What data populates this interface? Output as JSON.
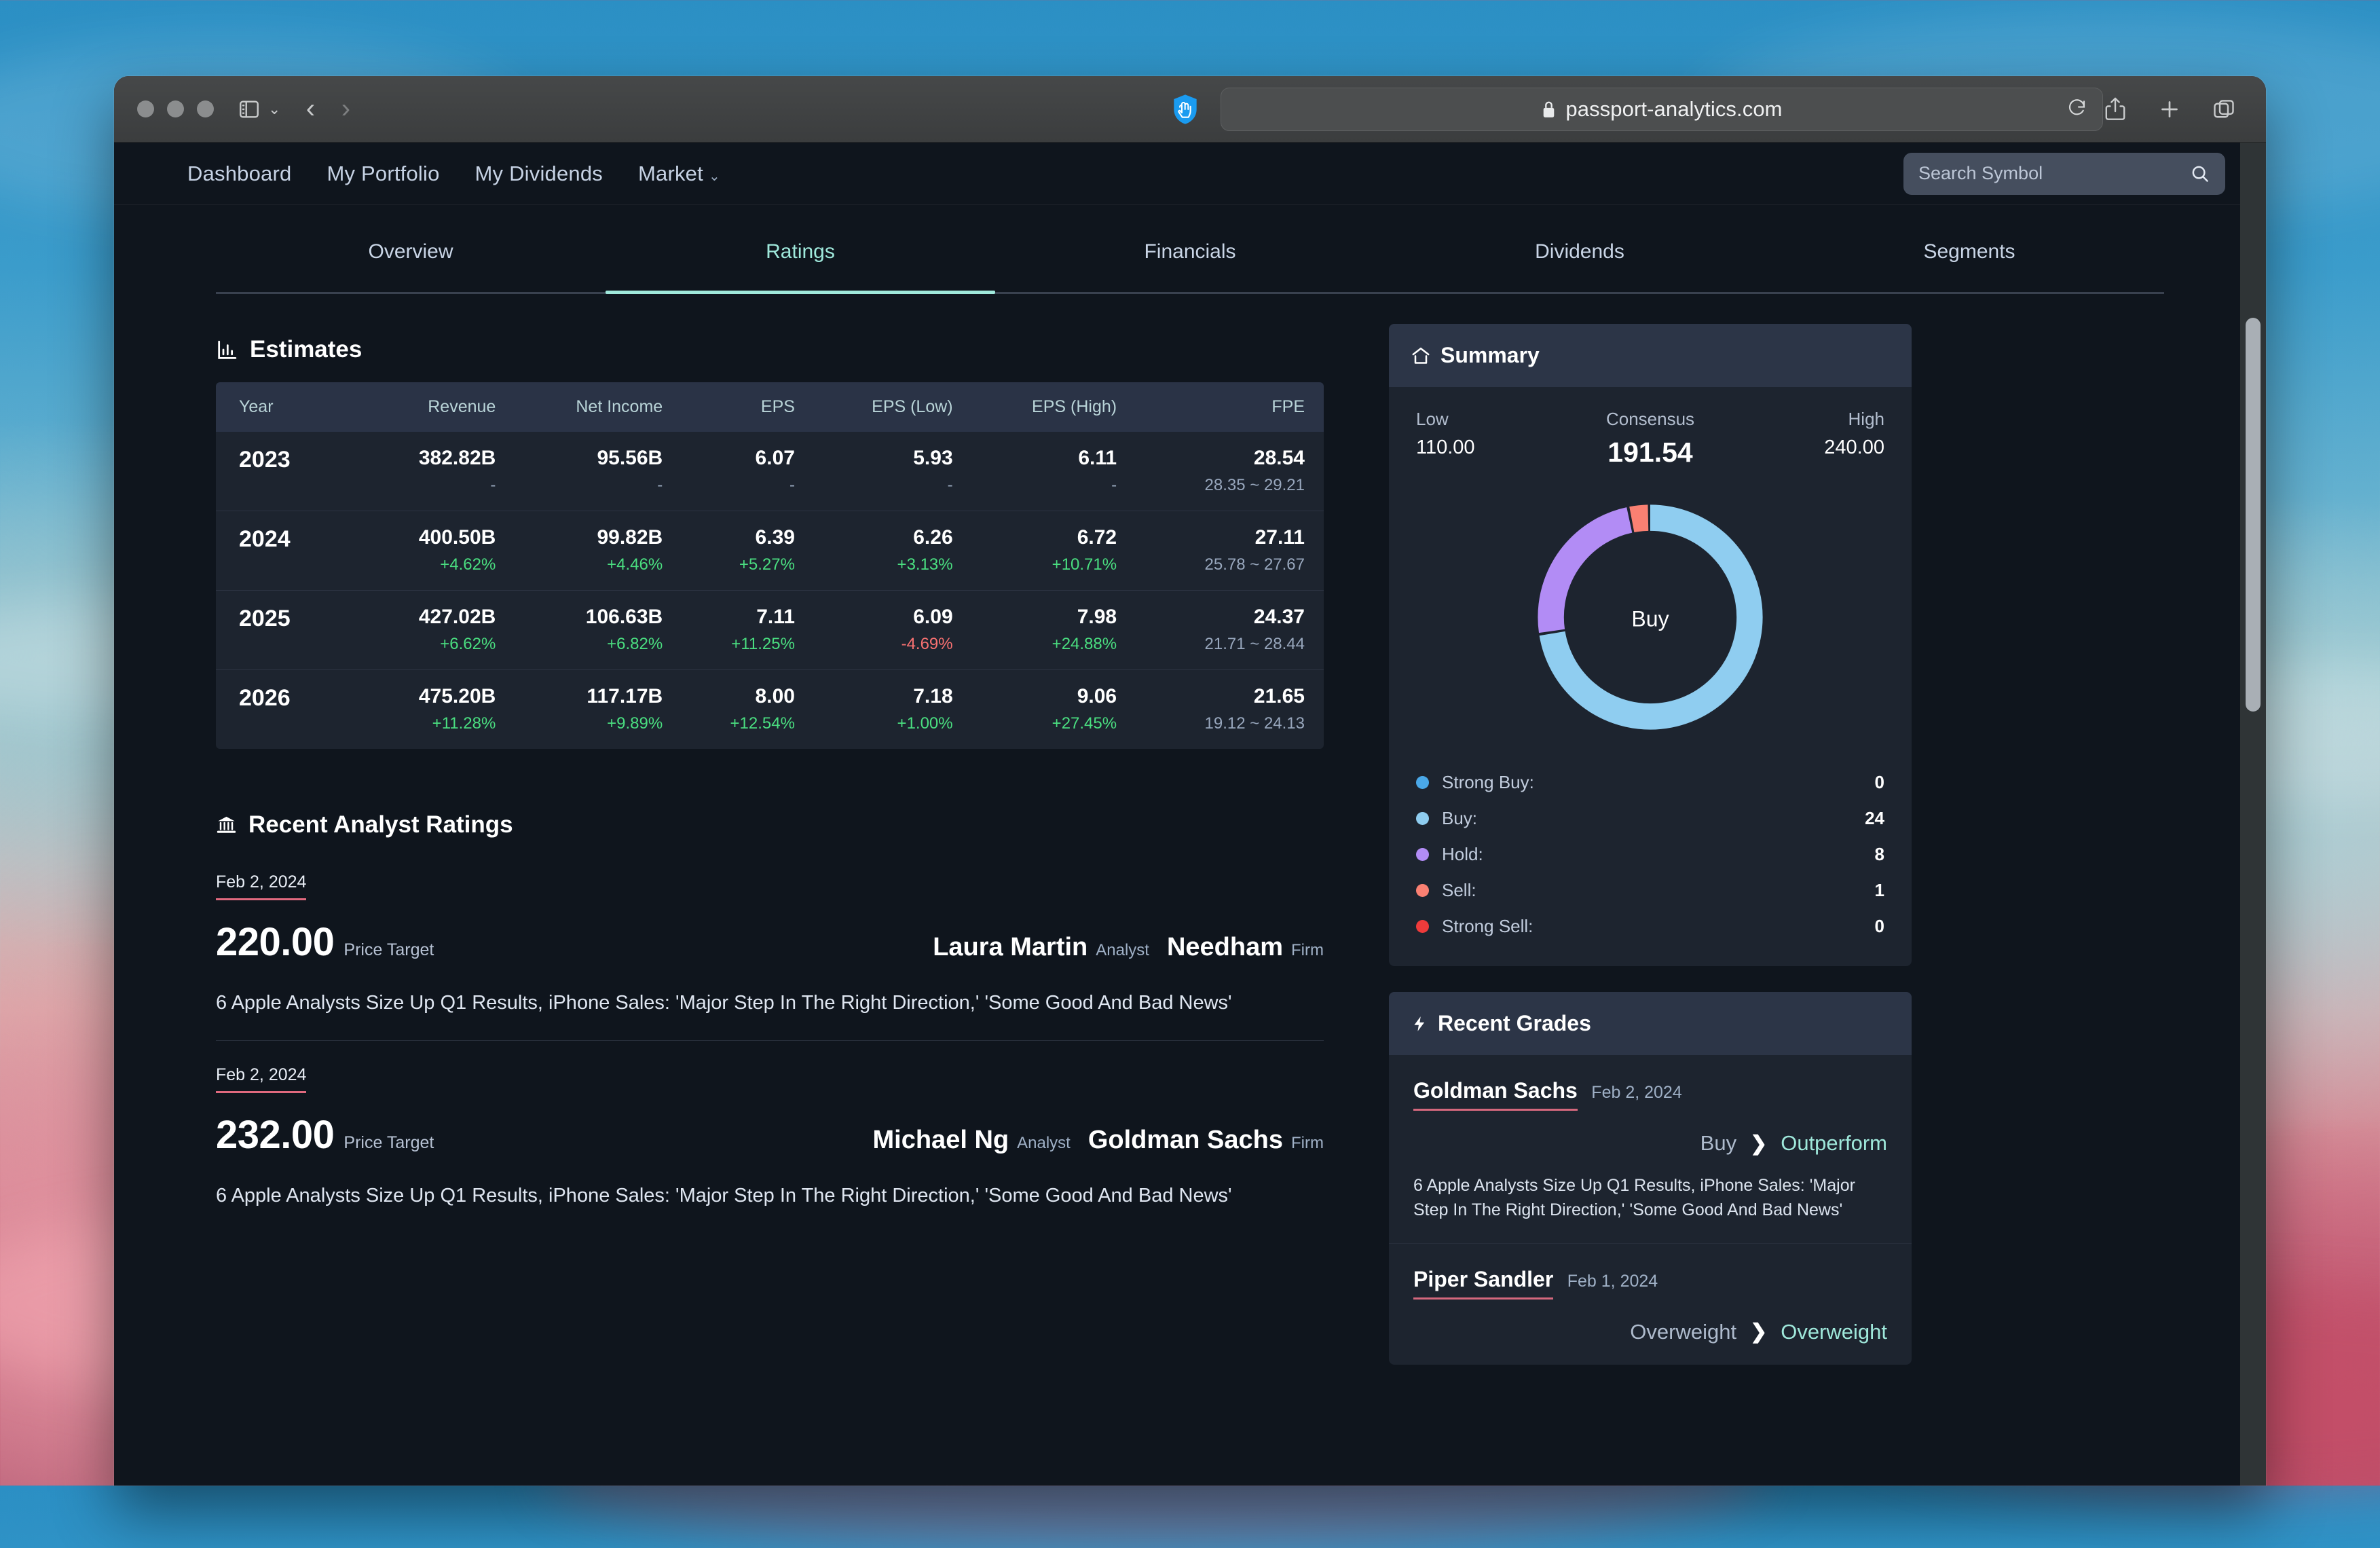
{
  "browser": {
    "url": "passport-analytics.com",
    "lock_icon": "lock-icon",
    "reload_icon": "reload-icon",
    "back_icon": "back-chevron-icon",
    "forward_icon": "forward-chevron-icon",
    "sidebar_icon": "sidebar-toggle-icon",
    "shield_icon": "extension-shield-icon",
    "share_icon": "share-icon",
    "new_tab_icon": "plus-icon",
    "tabs_icon": "tab-overview-icon"
  },
  "header": {
    "nav": [
      {
        "label": "Dashboard",
        "caret": ""
      },
      {
        "label": "My Portfolio",
        "caret": ""
      },
      {
        "label": "My Dividends",
        "caret": ""
      },
      {
        "label": "Market",
        "caret": "⌄"
      }
    ],
    "search": {
      "placeholder": "Search Symbol",
      "value": "",
      "icon": "search-icon"
    }
  },
  "tabs": [
    {
      "label": "Overview",
      "active": false
    },
    {
      "label": "Ratings",
      "active": true
    },
    {
      "label": "Financials",
      "active": false
    },
    {
      "label": "Dividends",
      "active": false
    },
    {
      "label": "Segments",
      "active": false
    }
  ],
  "estimates": {
    "title": "Estimates",
    "icon": "bar-chart-icon",
    "columns": [
      "Year",
      "Revenue",
      "Net Income",
      "EPS",
      "EPS (Low)",
      "EPS (High)",
      "FPE"
    ],
    "rows": [
      {
        "year": "2023",
        "revenue": "382.82B",
        "revenue_chg": "-",
        "revenue_dir": "neutral",
        "net_income": "95.56B",
        "net_income_chg": "-",
        "net_income_dir": "neutral",
        "eps": "6.07",
        "eps_chg": "-",
        "eps_dir": "neutral",
        "eps_low": "5.93",
        "eps_low_chg": "-",
        "eps_low_dir": "neutral",
        "eps_high": "6.11",
        "eps_high_chg": "-",
        "eps_high_dir": "neutral",
        "fpe": "28.54",
        "fpe_range": "28.35 ~ 29.21"
      },
      {
        "year": "2024",
        "revenue": "400.50B",
        "revenue_chg": "+4.62%",
        "revenue_dir": "pos",
        "net_income": "99.82B",
        "net_income_chg": "+4.46%",
        "net_income_dir": "pos",
        "eps": "6.39",
        "eps_chg": "+5.27%",
        "eps_dir": "pos",
        "eps_low": "6.26",
        "eps_low_chg": "+3.13%",
        "eps_low_dir": "pos",
        "eps_high": "6.72",
        "eps_high_chg": "+10.71%",
        "eps_high_dir": "pos",
        "fpe": "27.11",
        "fpe_range": "25.78 ~ 27.67"
      },
      {
        "year": "2025",
        "revenue": "427.02B",
        "revenue_chg": "+6.62%",
        "revenue_dir": "pos",
        "net_income": "106.63B",
        "net_income_chg": "+6.82%",
        "net_income_dir": "pos",
        "eps": "7.11",
        "eps_chg": "+11.25%",
        "eps_dir": "pos",
        "eps_low": "6.09",
        "eps_low_chg": "-4.69%",
        "eps_low_dir": "neg",
        "eps_high": "7.98",
        "eps_high_chg": "+24.88%",
        "eps_high_dir": "pos",
        "fpe": "24.37",
        "fpe_range": "21.71 ~ 28.44"
      },
      {
        "year": "2026",
        "revenue": "475.20B",
        "revenue_chg": "+11.28%",
        "revenue_dir": "pos",
        "net_income": "117.17B",
        "net_income_chg": "+9.89%",
        "net_income_dir": "pos",
        "eps": "8.00",
        "eps_chg": "+12.54%",
        "eps_dir": "pos",
        "eps_low": "7.18",
        "eps_low_chg": "+1.00%",
        "eps_low_dir": "pos",
        "eps_high": "9.06",
        "eps_high_chg": "+27.45%",
        "eps_high_dir": "pos",
        "fpe": "21.65",
        "fpe_range": "19.12 ~ 24.13"
      }
    ]
  },
  "analyst_ratings": {
    "title": "Recent Analyst Ratings",
    "icon": "bank-icon",
    "price_target_label": "Price Target",
    "analyst_label": "Analyst",
    "firm_label": "Firm",
    "items": [
      {
        "date": "Feb 2, 2024",
        "price": "220.00",
        "analyst": "Laura Martin",
        "firm": "Needham",
        "news": "6 Apple Analysts Size Up Q1 Results, iPhone Sales: 'Major Step In The Right Direction,' 'Some Good And Bad News'"
      },
      {
        "date": "Feb 2, 2024",
        "price": "232.00",
        "analyst": "Michael Ng",
        "firm": "Goldman Sachs",
        "news": "6 Apple Analysts Size Up Q1 Results, iPhone Sales: 'Major Step In The Right Direction,' 'Some Good And Bad News'"
      }
    ]
  },
  "summary": {
    "title": "Summary",
    "icon": "home-icon",
    "low_label": "Low",
    "low_value": "110.00",
    "consensus_label": "Consensus",
    "consensus_value": "191.54",
    "high_label": "High",
    "high_value": "240.00",
    "donut_center_label": "Buy",
    "legend": [
      {
        "label": "Strong Buy:",
        "value": "0",
        "color": "#4aa8e8"
      },
      {
        "label": "Buy:",
        "value": "24",
        "color": "#8fcdf0"
      },
      {
        "label": "Hold:",
        "value": "8",
        "color": "#b28cf5"
      },
      {
        "label": "Sell:",
        "value": "1",
        "color": "#fa8072"
      },
      {
        "label": "Strong Sell:",
        "value": "0",
        "color": "#ef3b3b"
      }
    ]
  },
  "recent_grades": {
    "title": "Recent Grades",
    "icon": "bolt-icon",
    "items": [
      {
        "firm": "Goldman Sachs",
        "date": "Feb 2, 2024",
        "from": "Buy",
        "arrow": "❯",
        "to": "Outperform",
        "news": "6 Apple Analysts Size Up Q1 Results, iPhone Sales: 'Major Step In The Right Direction,' 'Some Good And Bad News'"
      },
      {
        "firm": "Piper Sandler",
        "date": "Feb 1, 2024",
        "from": "Overweight",
        "arrow": "❯",
        "to": "Overweight",
        "news": ""
      }
    ]
  },
  "chart_data": {
    "type": "pie",
    "title": "Analyst Recommendation Distribution",
    "categories": [
      "Strong Buy",
      "Buy",
      "Hold",
      "Sell",
      "Strong Sell"
    ],
    "values": [
      0,
      24,
      8,
      1,
      0
    ],
    "colors": [
      "#4aa8e8",
      "#8fcdf0",
      "#b28cf5",
      "#fa8072",
      "#ef3b3b"
    ],
    "center_label": "Buy",
    "legend_position": "below",
    "total": 33
  }
}
